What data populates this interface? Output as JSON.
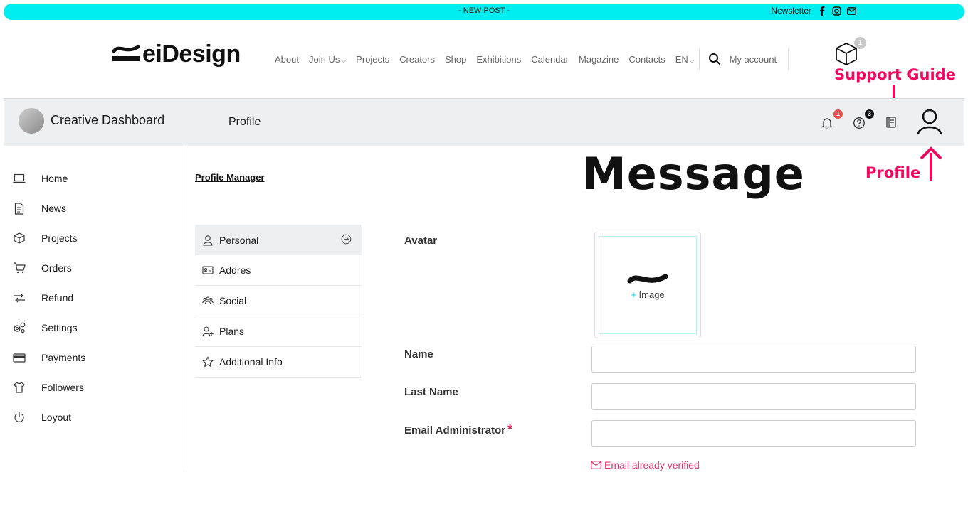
{
  "topbar": {
    "post_label": "- NEW POST -",
    "newsletter": "Newsletter",
    "social_icons": [
      "facebook-icon",
      "instagram-icon",
      "mail-icon"
    ]
  },
  "header": {
    "logo_text": "eiDesign",
    "nav": [
      "About",
      "Join Us",
      "Projects",
      "Creators",
      "Shop",
      "Exhibitions",
      "Calendar",
      "Magazine",
      "Contacts",
      "EN"
    ],
    "my_account": "My account",
    "cart_count": "1"
  },
  "annotations": {
    "support_guide": "Support  Guide",
    "profile": "Profile",
    "message": "Message"
  },
  "dashboard": {
    "title": "Creative Dashboard",
    "page": "Profile",
    "notifications_count": "1",
    "help_count": "3"
  },
  "sidebar": {
    "items": [
      "Home",
      "News",
      "Projects",
      "Orders",
      "Refund",
      "Settings",
      "Payments",
      "Followers",
      "Loyout"
    ]
  },
  "profile_manager": {
    "title": "Profile Manager",
    "menu": [
      "Personal",
      "Addres",
      "Social",
      "Plans",
      "Additional Info"
    ]
  },
  "form": {
    "avatar_label": "Avatar",
    "avatar_add_plus": "+",
    "avatar_add": "Image",
    "name_label": "Name",
    "last_name_label": "Last Name",
    "email_label": "Email Administrator",
    "required_mark": "*",
    "email_verified": "Email already verified"
  },
  "colors": {
    "topbar": "#00eef0",
    "annotation": "#f3075f",
    "badge_red": "#e2504c",
    "verified": "#e1346b"
  }
}
